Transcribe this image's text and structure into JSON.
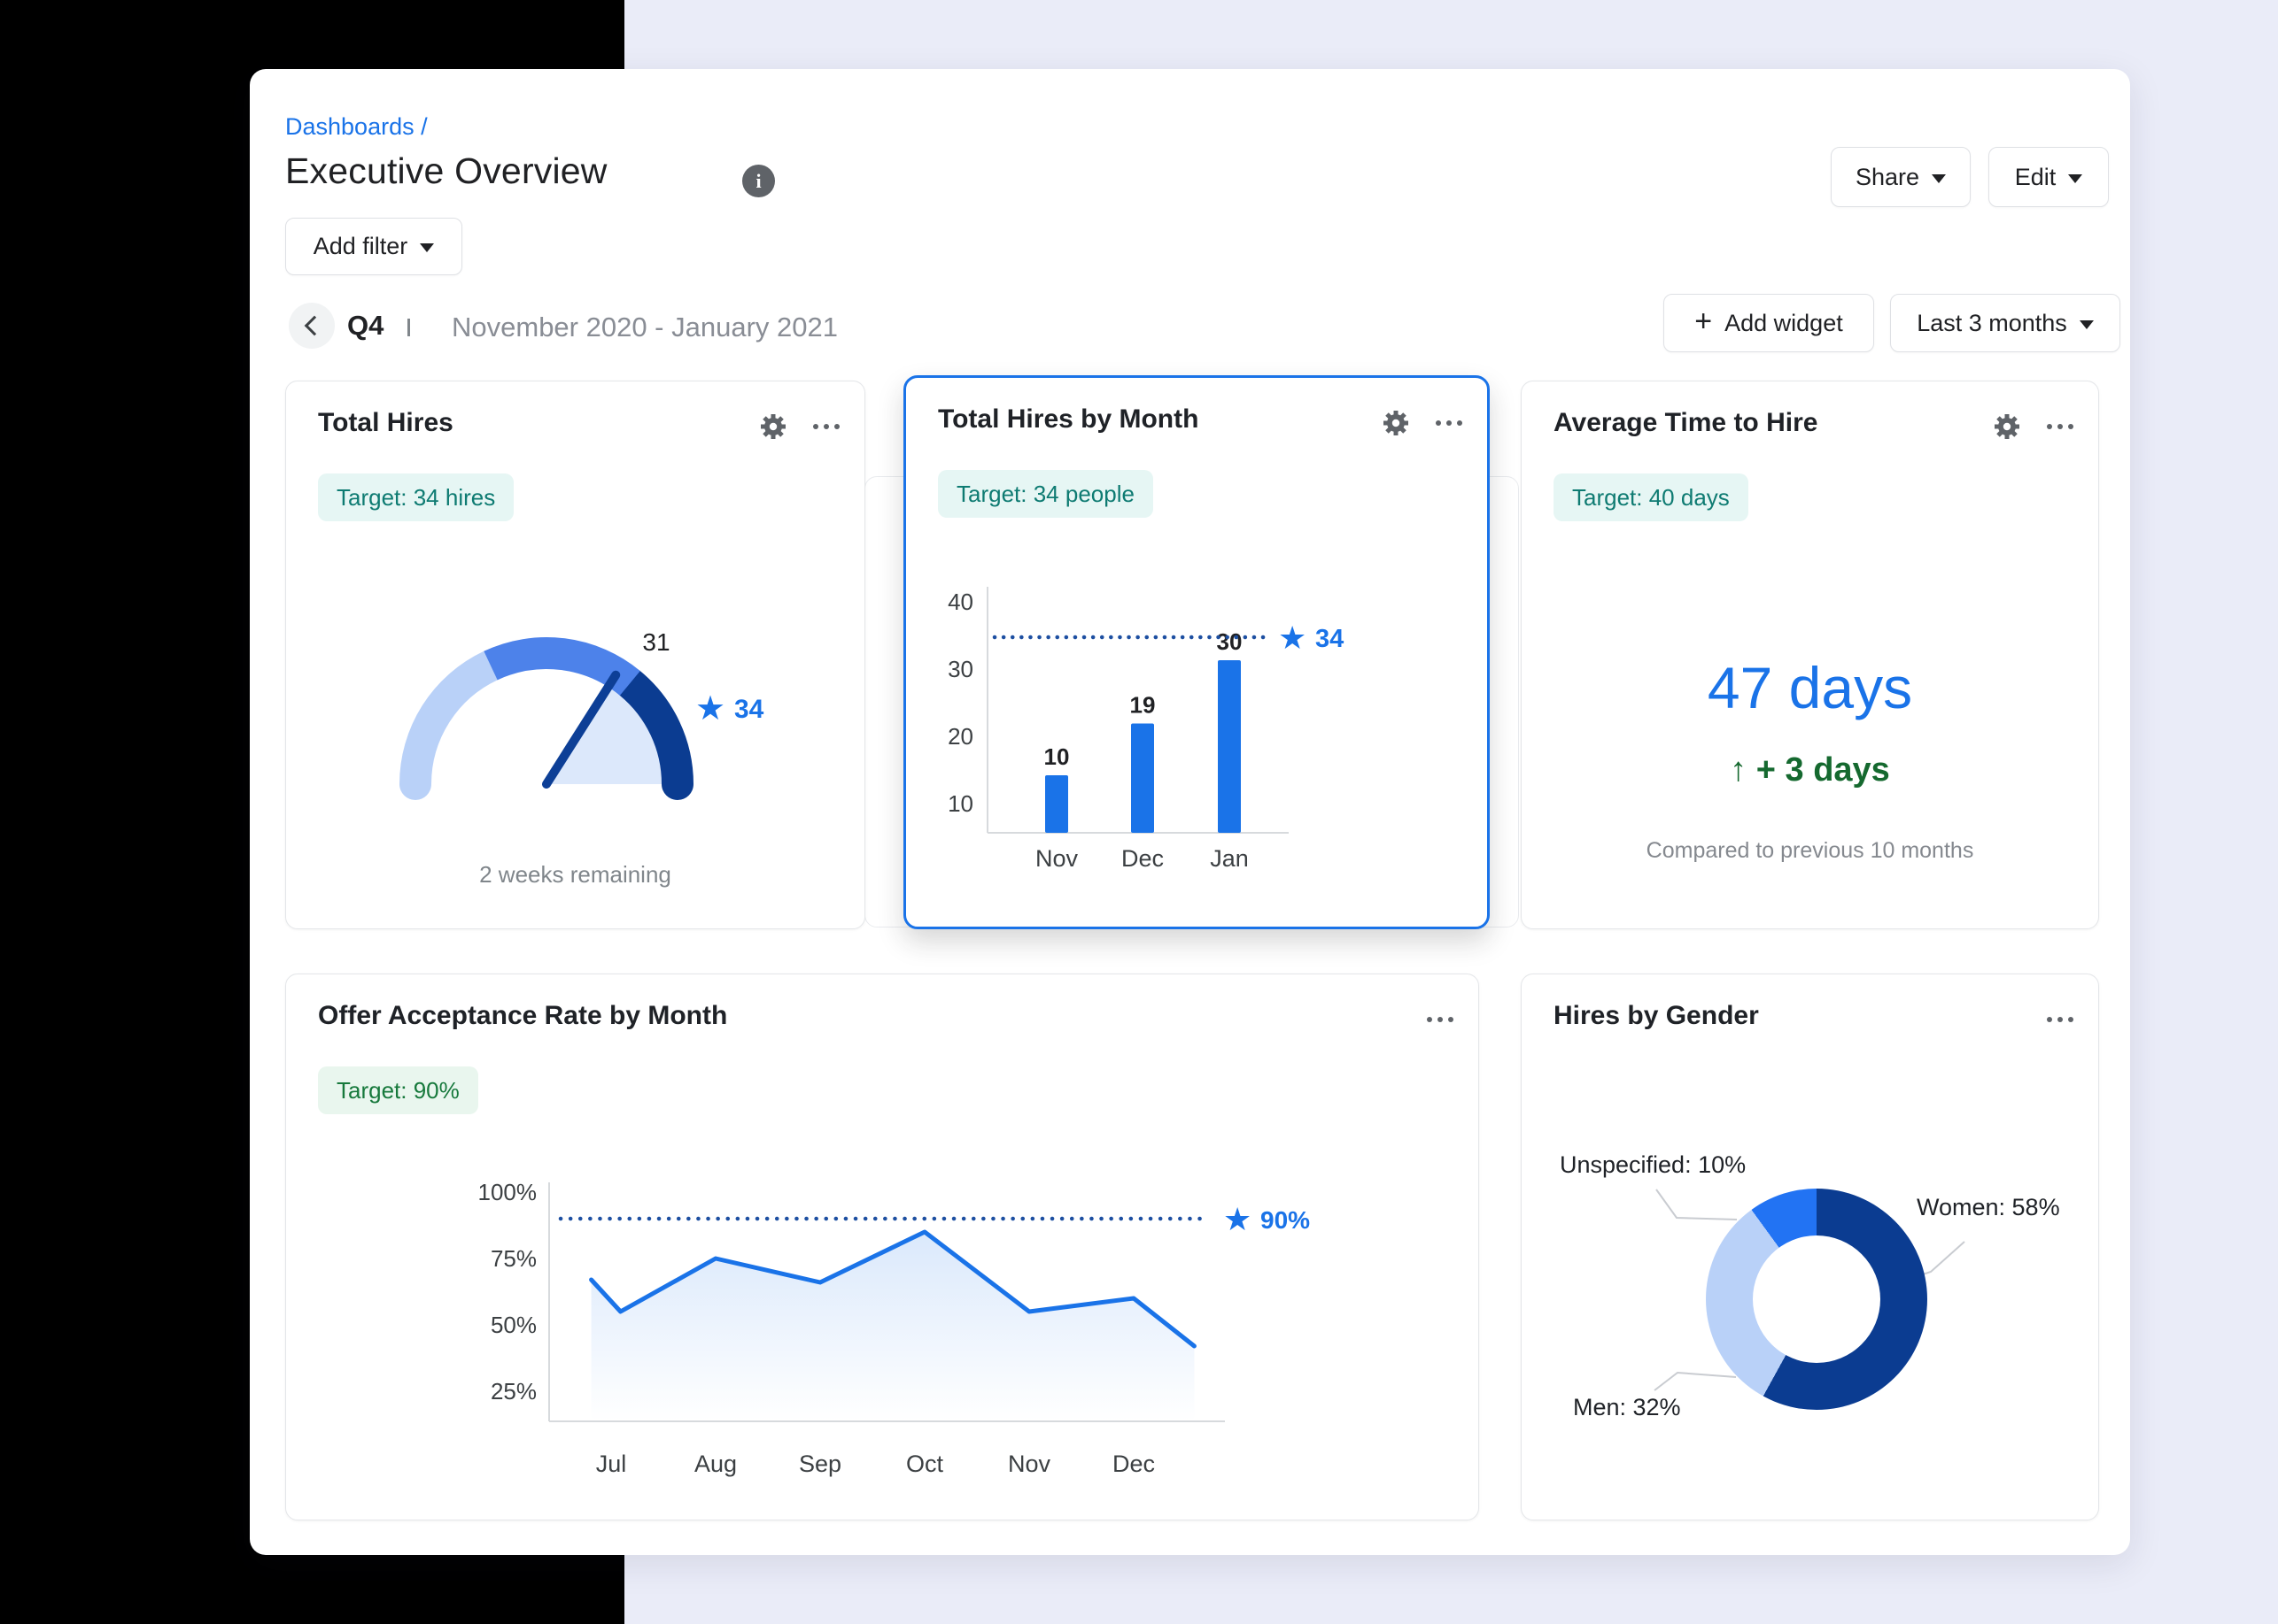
{
  "header": {
    "breadcrumb": "Dashboards /",
    "title": "Executive Overview",
    "share_label": "Share",
    "edit_label": "Edit",
    "add_filter_label": "Add filter"
  },
  "period_nav": {
    "quarter": "Q4",
    "range": "November 2020 - January 2021",
    "add_widget_plus": "+",
    "add_widget_label": "Add widget",
    "time_filter_label": "Last 3 months"
  },
  "colors": {
    "accent_blue": "#1a73e8",
    "navy": "#0b3c91",
    "mid_blue": "#4d82ea",
    "light_blue": "#b9d1f8",
    "pale_wedge": "#dce8fb",
    "bright_blue": "#2273f3",
    "dotted_line": "#1d4fa1",
    "teal_text": "#0e7b72",
    "green_text": "#17793c",
    "delta_green": "#15692f",
    "gray_text": "#85898f"
  },
  "widgets": {
    "total_hires": {
      "title": "Total Hires",
      "target_badge": "Target: 34 hires",
      "footnote": "2 weeks remaining"
    },
    "hires_by_month": {
      "title": "Total Hires by Month",
      "target_badge": "Target: 34 people"
    },
    "avg_time_to_hire": {
      "title": "Average Time to Hire",
      "target_badge": "Target: 40 days",
      "value": "47 days",
      "delta": "+ 3 days",
      "delta_arrow": "↑",
      "note": "Compared to previous 10 months"
    },
    "offer_acceptance": {
      "title": "Offer Acceptance Rate by Month",
      "target_badge": "Target: 90%"
    },
    "hires_by_gender": {
      "title": "Hires by Gender",
      "labels": {
        "unspecified": "Unspecified: 10%",
        "women": "Women: 58%",
        "men": "Men: 32%"
      }
    }
  },
  "chart_data": [
    {
      "id": "total-hires-gauge",
      "type": "gauge",
      "title": "Total Hires",
      "value": 31,
      "value_label": "31",
      "target": 34,
      "target_label": "34",
      "needle_fraction": 0.68,
      "segments": [
        {
          "frac": 0.36,
          "color": "#b9d1f8"
        },
        {
          "frac": 0.36,
          "color": "#4d82ea"
        },
        {
          "frac": 0.28,
          "color": "#0b3c91"
        }
      ],
      "wedge_color": "#dce8fb",
      "needle_color": "#0d3f96",
      "footnote": "2 weeks remaining"
    },
    {
      "id": "total-hires-by-month",
      "type": "bar",
      "title": "Total Hires by Month",
      "categories": [
        "Nov",
        "Dec",
        "Jan"
      ],
      "values": [
        10,
        19,
        30
      ],
      "target": 34,
      "target_label": "34",
      "y_ticks": [
        40,
        30,
        20,
        10
      ],
      "ylim": [
        0,
        40
      ],
      "bar_color": "#1a73e8"
    },
    {
      "id": "offer-acceptance-rate",
      "type": "line",
      "title": "Offer Acceptance Rate by Month",
      "months": [
        "Jul",
        "Aug",
        "Sep",
        "Oct",
        "Nov",
        "Dec"
      ],
      "points": [
        {
          "x": -0.19,
          "y": 67
        },
        {
          "x": 0.09,
          "y": 55
        },
        {
          "x": 1,
          "y": 75
        },
        {
          "x": 2,
          "y": 66
        },
        {
          "x": 3,
          "y": 85
        },
        {
          "x": 4,
          "y": 55
        },
        {
          "x": 5,
          "y": 60
        },
        {
          "x": 5.58,
          "y": 42
        }
      ],
      "target": 90,
      "target_label": "90%",
      "y_ticks": [
        "100%",
        "75%",
        "50%",
        "25%"
      ],
      "y_tick_values": [
        100,
        75,
        50,
        25
      ],
      "line_color": "#1a73e8"
    },
    {
      "id": "hires-by-gender",
      "type": "donut",
      "title": "Hires by Gender",
      "slices": [
        {
          "label": "Women",
          "pct": 58,
          "color": "#0b3c91"
        },
        {
          "label": "Men",
          "pct": 32,
          "color": "#b9d1f8"
        },
        {
          "label": "Unspecified",
          "pct": 10,
          "color": "#2273f3"
        }
      ]
    }
  ]
}
